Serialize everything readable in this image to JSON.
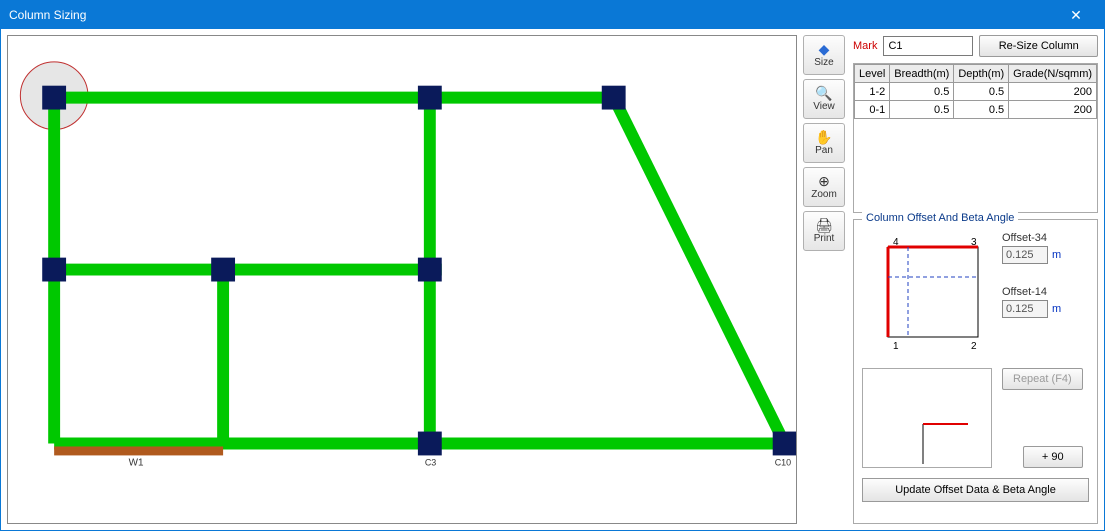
{
  "window": {
    "title": "Column Sizing"
  },
  "toolbar": {
    "size": "Size",
    "view": "View",
    "pan": "Pan",
    "zoom": "Zoom",
    "print": "Print"
  },
  "mark": {
    "label": "Mark",
    "value": "C1",
    "resize_btn": "Re-Size Column"
  },
  "grid": {
    "headers": {
      "level": "Level",
      "breadth": "Breadth(m)",
      "depth": "Depth(m)",
      "grade": "Grade(N/sqmm)"
    },
    "rows": [
      {
        "level": "1-2",
        "breadth": "0.5",
        "depth": "0.5",
        "grade": "200"
      },
      {
        "level": "0-1",
        "breadth": "0.5",
        "depth": "0.5",
        "grade": "200"
      }
    ]
  },
  "offset": {
    "legend": "Column Offset And Beta Angle",
    "corners": {
      "tl": "4",
      "tr": "3",
      "bl": "1",
      "br": "2"
    },
    "o34_label": "Offset-34",
    "o34_value": "0.125",
    "o14_label": "Offset-14",
    "o14_value": "0.125",
    "unit": "m",
    "repeat_btn": "Repeat (F4)",
    "plus90_btn": "+ 90",
    "update_btn": "Update Offset Data & Beta Angle"
  },
  "canvas": {
    "selected_label": "",
    "wall_label": "W1",
    "col_label_c3": "C3",
    "col_label_c10": "C10"
  },
  "chart_data": {
    "type": "table",
    "title": "Column section sizes by level",
    "columns": [
      "Level",
      "Breadth(m)",
      "Depth(m)",
      "Grade(N/sqmm)"
    ],
    "rows": [
      [
        "1-2",
        0.5,
        0.5,
        200
      ],
      [
        "0-1",
        0.5,
        0.5,
        200
      ]
    ]
  }
}
